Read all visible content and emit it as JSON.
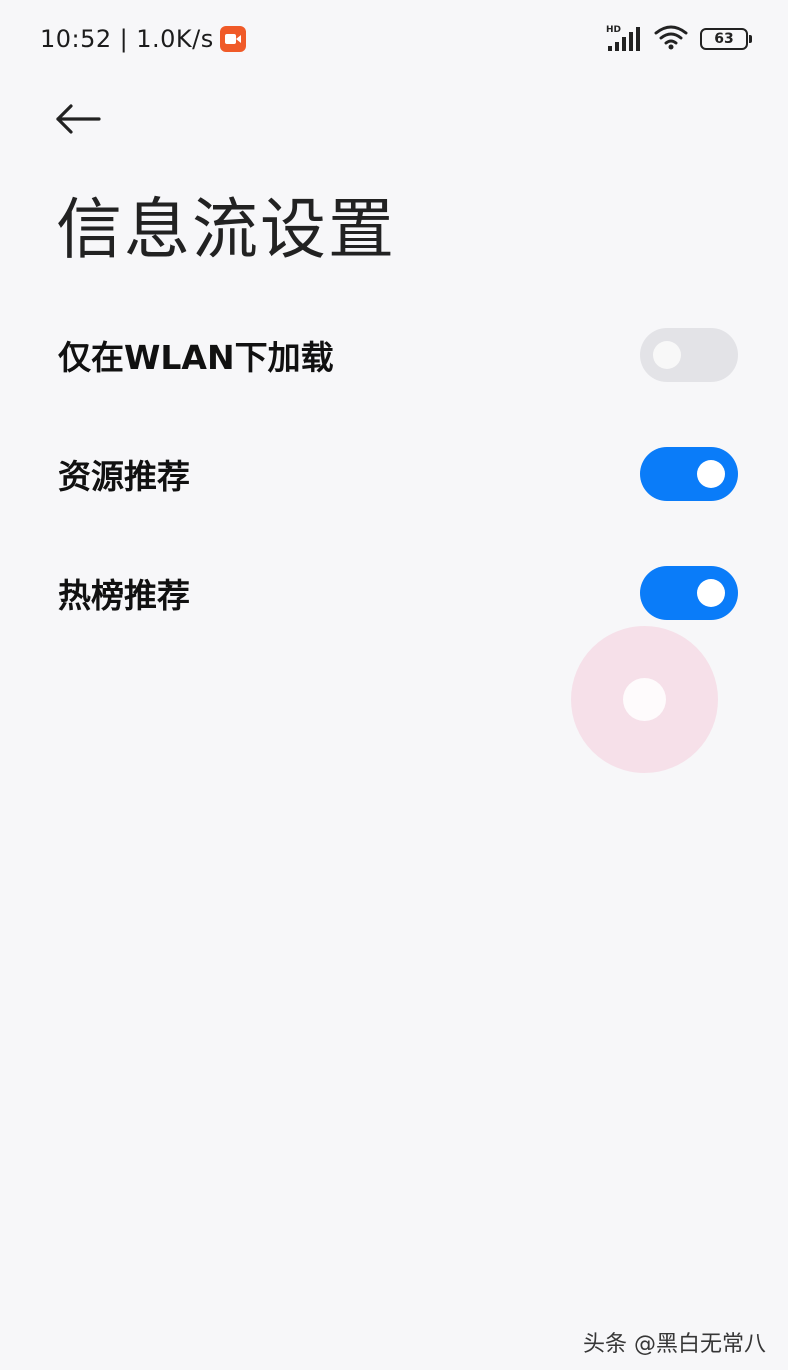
{
  "status_bar": {
    "time": "10:52",
    "separator": "|",
    "net_speed": "1.0K/s",
    "signal_label": "HD",
    "battery_level": "63",
    "recording_icon": "video-record-icon",
    "wifi_icon": "wifi-icon",
    "signal_icon": "cellular-signal-icon"
  },
  "header": {
    "back_icon": "arrow-left-icon",
    "title": "信息流设置"
  },
  "settings": [
    {
      "label": "仅在WLAN下加载",
      "enabled": false
    },
    {
      "label": "资源推荐",
      "enabled": true
    },
    {
      "label": "热榜推荐",
      "enabled": true
    }
  ],
  "colors": {
    "accent": "#0a7cf9",
    "toggle_off": "#e3e3e7",
    "background": "#f7f7f9",
    "record_badge": "#f05a28"
  },
  "watermark": "头条 @黑白无常八"
}
